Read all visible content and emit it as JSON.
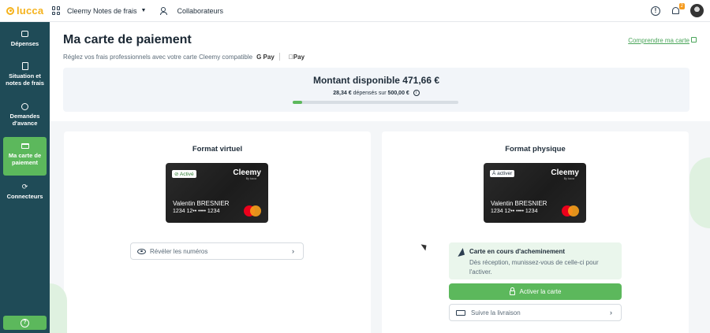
{
  "topbar": {
    "logo": "lucca",
    "app_name": "Cleemy Notes de frais",
    "nav_link": "Collaborateurs",
    "notification_count": "2"
  },
  "sidebar": {
    "items": [
      {
        "label": "Dépenses",
        "icon": "wallet-icon"
      },
      {
        "label": "Situation et notes de frais",
        "icon": "document-icon"
      },
      {
        "label": "Demandes d'avance",
        "icon": "money-bag-icon"
      },
      {
        "label": "Ma carte de paiement",
        "icon": "card-icon",
        "active": true
      },
      {
        "label": "Connecteurs",
        "icon": "sync-icon"
      }
    ]
  },
  "header": {
    "title": "Ma carte de paiement",
    "subtitle": "Réglez vos frais professionnels avec votre carte Cleemy compatible",
    "pay_google": "G Pay",
    "pay_apple": "Pay",
    "help_link": "Comprendre ma carte"
  },
  "balance": {
    "title": "Montant disponible 471,66 €",
    "spent": "28,34 €",
    "spent_middle": "dépensés sur",
    "limit": "500,00 €",
    "progress_fraction": 0.0567
  },
  "virtual": {
    "title": "Format virtuel",
    "status": "Activé",
    "brand": "Cleemy",
    "brand_sub": "By lucca",
    "holder": "Valentin BRESNIER",
    "number": "1234 12•• •••• 1234",
    "reveal_label": "Révéler les numéros"
  },
  "physical": {
    "title": "Format physique",
    "status": "À activer",
    "brand": "Cleemy",
    "brand_sub": "By lucca",
    "holder": "Valentin BRESNIER",
    "number": "1234 12•• •••• 1234",
    "notice_title": "Carte en cours d'acheminement",
    "notice_text": "Dès réception, munissez-vous de celle-ci pour l'activer.",
    "activate_label": "Activer la carte",
    "tracking_label": "Suivre la livraison"
  },
  "colors": {
    "accent": "#5cb85c",
    "sidebar": "#1f4b57",
    "brand": "#f5b21c"
  }
}
